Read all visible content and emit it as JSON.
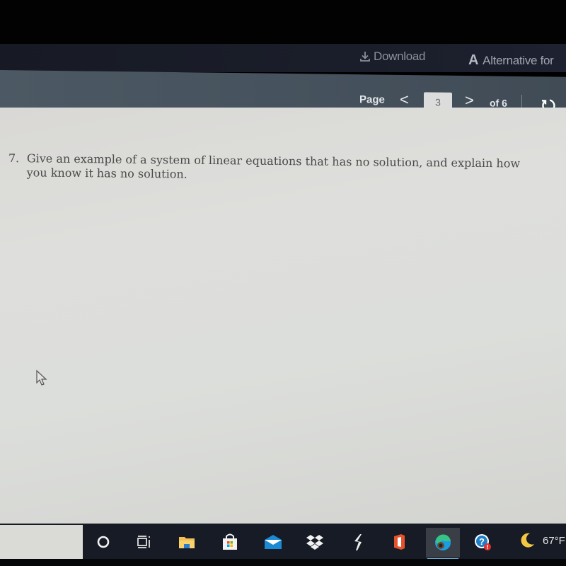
{
  "topbar": {
    "download_label": "Download",
    "alternative_label": "Alternative for",
    "alternative_icon": "A"
  },
  "toolbar": {
    "page_label": "Page",
    "prev_glyph": "<",
    "current_page": "3",
    "next_glyph": ">",
    "total_label": "of 6"
  },
  "document": {
    "question_number": "7.",
    "question_line1": "Give an example of a system of linear equations that has no solution, and explain how",
    "question_line2": "you know it has no solution."
  },
  "taskbar": {
    "items": [
      {
        "name": "cortana-search",
        "icon": "circle-icon"
      },
      {
        "name": "task-view",
        "icon": "task-view-icon"
      },
      {
        "name": "file-explorer",
        "icon": "folder-icon"
      },
      {
        "name": "microsoft-store",
        "icon": "store-bag-icon"
      },
      {
        "name": "mail",
        "icon": "mail-icon"
      },
      {
        "name": "dropbox",
        "icon": "dropbox-icon"
      },
      {
        "name": "app-lightning",
        "icon": "lightning-icon"
      },
      {
        "name": "office",
        "icon": "office-icon"
      },
      {
        "name": "edge",
        "icon": "edge-icon",
        "active": true
      },
      {
        "name": "help-tips",
        "icon": "help-icon"
      }
    ],
    "weather": {
      "icon": "moon-icon",
      "temperature": "67°F"
    }
  },
  "colors": {
    "topbar_bg": "#171a24",
    "toolbar_bg": "#46525d",
    "document_bg": "#dcdedb",
    "taskbar_bg": "#161b25",
    "edge_active_underline": "#6fb0d8"
  }
}
